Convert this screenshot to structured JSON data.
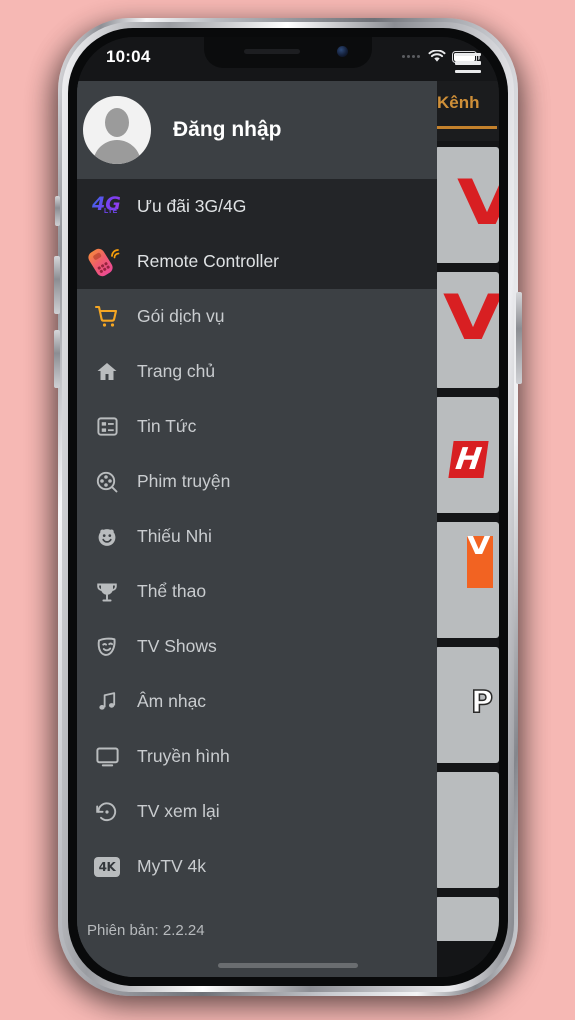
{
  "status_bar": {
    "time": "10:04",
    "wifi_icon": "wifi-icon",
    "battery_icon": "battery-full-icon",
    "signal_icon": "signal-dots-icon"
  },
  "drawer": {
    "header": {
      "avatar_icon": "avatar-placeholder-icon",
      "login_label": "Đăng nhập"
    },
    "version_label": "Phiên bản: 2.2.24",
    "items": [
      {
        "label": "Ưu đãi 3G/4G",
        "icon": "4g-lte-icon",
        "style": "dark-accent"
      },
      {
        "label": "Remote Controller",
        "icon": "remote-control-icon",
        "style": "dark"
      },
      {
        "label": "Gói dịch vụ",
        "icon": "shopping-cart-icon",
        "style": "normal"
      },
      {
        "label": "Trang chủ",
        "icon": "home-icon",
        "style": "normal"
      },
      {
        "label": "Tin Tức",
        "icon": "news-list-icon",
        "style": "normal"
      },
      {
        "label": "Phim truyện",
        "icon": "film-reel-icon",
        "style": "normal"
      },
      {
        "label": "Thiếu Nhi",
        "icon": "smiley-child-icon",
        "style": "normal"
      },
      {
        "label": "Thể thao",
        "icon": "trophy-icon",
        "style": "normal"
      },
      {
        "label": "TV Shows",
        "icon": "theater-mask-icon",
        "style": "normal"
      },
      {
        "label": "Âm nhạc",
        "icon": "music-note-icon",
        "style": "normal"
      },
      {
        "label": "Truyền hình",
        "icon": "tv-monitor-icon",
        "style": "normal"
      },
      {
        "label": "TV xem lại",
        "icon": "replay-icon",
        "style": "normal"
      },
      {
        "label": "MyTV 4k",
        "icon": "4k-badge-icon",
        "style": "normal"
      }
    ]
  },
  "main": {
    "menu_icon": "hamburger-menu-icon",
    "tabs": [
      {
        "label": "Kênh",
        "active": true
      }
    ],
    "channels": [
      {
        "logo": "vtv-red-v-logo"
      },
      {
        "logo": "vtv-red-v-logo"
      },
      {
        "logo": "htv-red-h-logo"
      },
      {
        "logo": "vtc-orange-v-logo"
      },
      {
        "logo": "p-white-logo"
      },
      {
        "logo": "blank-logo"
      },
      {
        "logo": "blank-logo"
      }
    ]
  },
  "colors": {
    "drawer_bg": "#3c4044",
    "drawer_dark_row": "#232528",
    "accent_blue": "#3d8ef0",
    "accent_orange": "#c4812c",
    "cart_orange": "#f5a623",
    "page_bg": "#f6b8b4"
  }
}
